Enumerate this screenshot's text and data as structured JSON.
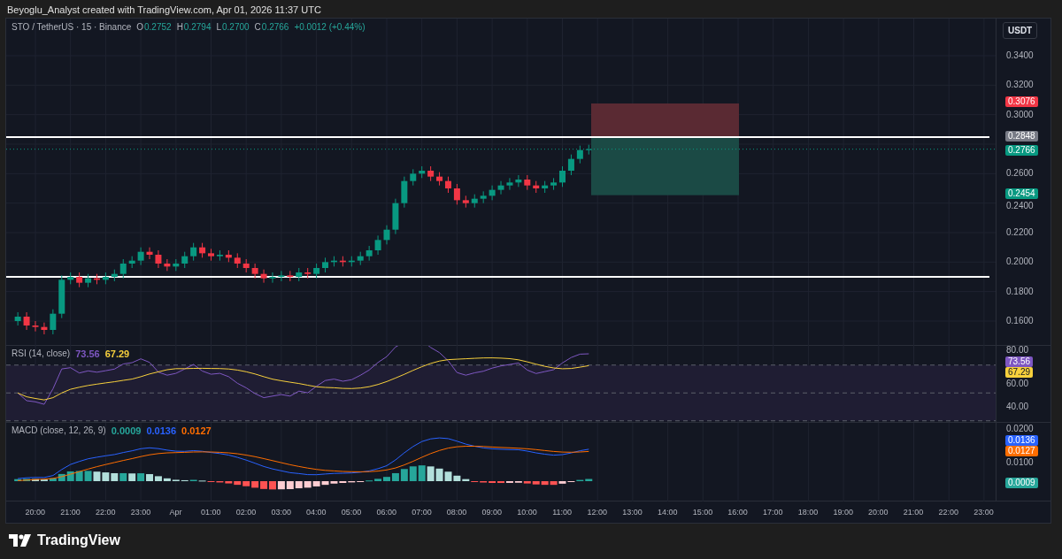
{
  "header": {
    "text": "Beyoglu_Analyst created with TradingView.com, Apr 01, 2026 11:37 UTC"
  },
  "legend": {
    "symbol": "STO / TetherUS · 15 · Binance",
    "ohlc": [
      {
        "label": "O",
        "value": "0.2752"
      },
      {
        "label": "H",
        "value": "0.2794"
      },
      {
        "label": "L",
        "value": "0.2700"
      },
      {
        "label": "C",
        "value": "0.2766"
      }
    ],
    "change": "+0.0012 (+0.44%)"
  },
  "currency_button": "USDT",
  "price_axis": {
    "ticks": [
      "0.3400",
      "0.3200",
      "0.3000",
      "0.2600",
      "0.2400",
      "0.2200",
      "0.2000",
      "0.1800",
      "0.1600"
    ],
    "badges": [
      {
        "value": "0.3076",
        "color": "#f23645"
      },
      {
        "value": "0.2848",
        "color": "#787b86"
      },
      {
        "value": "0.2766",
        "color": "#089981"
      },
      {
        "value": "0.2454",
        "color": "#089981"
      }
    ]
  },
  "rsi": {
    "title": "RSI (14, close)",
    "values": [
      {
        "value": "73.56",
        "color": "#7e57c2"
      },
      {
        "value": "67.29",
        "color": "#f7d03c"
      }
    ],
    "ticks": [
      "80.00",
      "60.00",
      "40.00"
    ],
    "badges": [
      {
        "value": "73.56",
        "color": "#7e57c2"
      },
      {
        "value": "67.29",
        "color": "#f7d03c"
      }
    ]
  },
  "macd": {
    "title": "MACD (close, 12, 26, 9)",
    "values": [
      {
        "value": "0.0009",
        "color": "#26a69a"
      },
      {
        "value": "0.0136",
        "color": "#2962ff"
      },
      {
        "value": "0.0127",
        "color": "#ff6d00"
      }
    ],
    "ticks": [
      "0.0200",
      "0.0100"
    ],
    "badges": [
      {
        "value": "0.0136",
        "color": "#2962ff"
      },
      {
        "value": "0.0127",
        "color": "#ff6d00"
      },
      {
        "value": "0.0009",
        "color": "#26a69a"
      }
    ]
  },
  "time_axis": [
    "20:00",
    "21:00",
    "22:00",
    "23:00",
    "Apr",
    "01:00",
    "02:00",
    "03:00",
    "04:00",
    "05:00",
    "06:00",
    "07:00",
    "08:00",
    "09:00",
    "10:00",
    "11:00",
    "12:00",
    "13:00",
    "14:00",
    "15:00",
    "16:00",
    "17:00",
    "18:00",
    "19:00",
    "20:00",
    "21:00",
    "22:00",
    "23:00"
  ],
  "footer": {
    "logo": "TradingView"
  }
}
